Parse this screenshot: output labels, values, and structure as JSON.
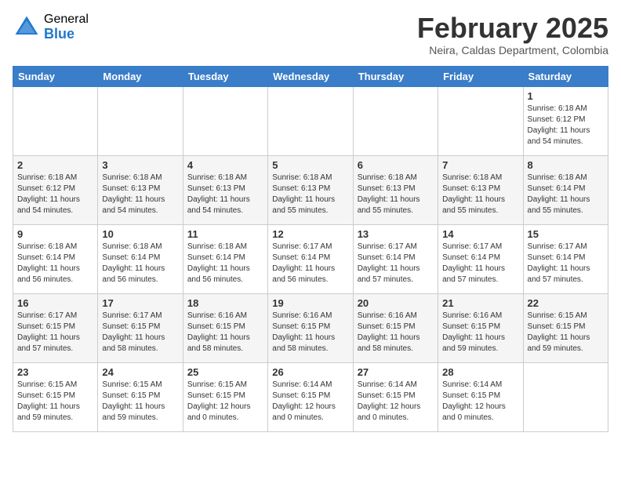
{
  "header": {
    "logo_general": "General",
    "logo_blue": "Blue",
    "month_year": "February 2025",
    "location": "Neira, Caldas Department, Colombia"
  },
  "weekdays": [
    "Sunday",
    "Monday",
    "Tuesday",
    "Wednesday",
    "Thursday",
    "Friday",
    "Saturday"
  ],
  "weeks": [
    [
      {
        "day": "",
        "info": ""
      },
      {
        "day": "",
        "info": ""
      },
      {
        "day": "",
        "info": ""
      },
      {
        "day": "",
        "info": ""
      },
      {
        "day": "",
        "info": ""
      },
      {
        "day": "",
        "info": ""
      },
      {
        "day": "1",
        "info": "Sunrise: 6:18 AM\nSunset: 6:12 PM\nDaylight: 11 hours\nand 54 minutes."
      }
    ],
    [
      {
        "day": "2",
        "info": "Sunrise: 6:18 AM\nSunset: 6:12 PM\nDaylight: 11 hours\nand 54 minutes."
      },
      {
        "day": "3",
        "info": "Sunrise: 6:18 AM\nSunset: 6:13 PM\nDaylight: 11 hours\nand 54 minutes."
      },
      {
        "day": "4",
        "info": "Sunrise: 6:18 AM\nSunset: 6:13 PM\nDaylight: 11 hours\nand 54 minutes."
      },
      {
        "day": "5",
        "info": "Sunrise: 6:18 AM\nSunset: 6:13 PM\nDaylight: 11 hours\nand 55 minutes."
      },
      {
        "day": "6",
        "info": "Sunrise: 6:18 AM\nSunset: 6:13 PM\nDaylight: 11 hours\nand 55 minutes."
      },
      {
        "day": "7",
        "info": "Sunrise: 6:18 AM\nSunset: 6:13 PM\nDaylight: 11 hours\nand 55 minutes."
      },
      {
        "day": "8",
        "info": "Sunrise: 6:18 AM\nSunset: 6:14 PM\nDaylight: 11 hours\nand 55 minutes."
      }
    ],
    [
      {
        "day": "9",
        "info": "Sunrise: 6:18 AM\nSunset: 6:14 PM\nDaylight: 11 hours\nand 56 minutes."
      },
      {
        "day": "10",
        "info": "Sunrise: 6:18 AM\nSunset: 6:14 PM\nDaylight: 11 hours\nand 56 minutes."
      },
      {
        "day": "11",
        "info": "Sunrise: 6:18 AM\nSunset: 6:14 PM\nDaylight: 11 hours\nand 56 minutes."
      },
      {
        "day": "12",
        "info": "Sunrise: 6:17 AM\nSunset: 6:14 PM\nDaylight: 11 hours\nand 56 minutes."
      },
      {
        "day": "13",
        "info": "Sunrise: 6:17 AM\nSunset: 6:14 PM\nDaylight: 11 hours\nand 57 minutes."
      },
      {
        "day": "14",
        "info": "Sunrise: 6:17 AM\nSunset: 6:14 PM\nDaylight: 11 hours\nand 57 minutes."
      },
      {
        "day": "15",
        "info": "Sunrise: 6:17 AM\nSunset: 6:14 PM\nDaylight: 11 hours\nand 57 minutes."
      }
    ],
    [
      {
        "day": "16",
        "info": "Sunrise: 6:17 AM\nSunset: 6:15 PM\nDaylight: 11 hours\nand 57 minutes."
      },
      {
        "day": "17",
        "info": "Sunrise: 6:17 AM\nSunset: 6:15 PM\nDaylight: 11 hours\nand 58 minutes."
      },
      {
        "day": "18",
        "info": "Sunrise: 6:16 AM\nSunset: 6:15 PM\nDaylight: 11 hours\nand 58 minutes."
      },
      {
        "day": "19",
        "info": "Sunrise: 6:16 AM\nSunset: 6:15 PM\nDaylight: 11 hours\nand 58 minutes."
      },
      {
        "day": "20",
        "info": "Sunrise: 6:16 AM\nSunset: 6:15 PM\nDaylight: 11 hours\nand 58 minutes."
      },
      {
        "day": "21",
        "info": "Sunrise: 6:16 AM\nSunset: 6:15 PM\nDaylight: 11 hours\nand 59 minutes."
      },
      {
        "day": "22",
        "info": "Sunrise: 6:15 AM\nSunset: 6:15 PM\nDaylight: 11 hours\nand 59 minutes."
      }
    ],
    [
      {
        "day": "23",
        "info": "Sunrise: 6:15 AM\nSunset: 6:15 PM\nDaylight: 11 hours\nand 59 minutes."
      },
      {
        "day": "24",
        "info": "Sunrise: 6:15 AM\nSunset: 6:15 PM\nDaylight: 11 hours\nand 59 minutes."
      },
      {
        "day": "25",
        "info": "Sunrise: 6:15 AM\nSunset: 6:15 PM\nDaylight: 12 hours\nand 0 minutes."
      },
      {
        "day": "26",
        "info": "Sunrise: 6:14 AM\nSunset: 6:15 PM\nDaylight: 12 hours\nand 0 minutes."
      },
      {
        "day": "27",
        "info": "Sunrise: 6:14 AM\nSunset: 6:15 PM\nDaylight: 12 hours\nand 0 minutes."
      },
      {
        "day": "28",
        "info": "Sunrise: 6:14 AM\nSunset: 6:15 PM\nDaylight: 12 hours\nand 0 minutes."
      },
      {
        "day": "",
        "info": ""
      }
    ]
  ]
}
